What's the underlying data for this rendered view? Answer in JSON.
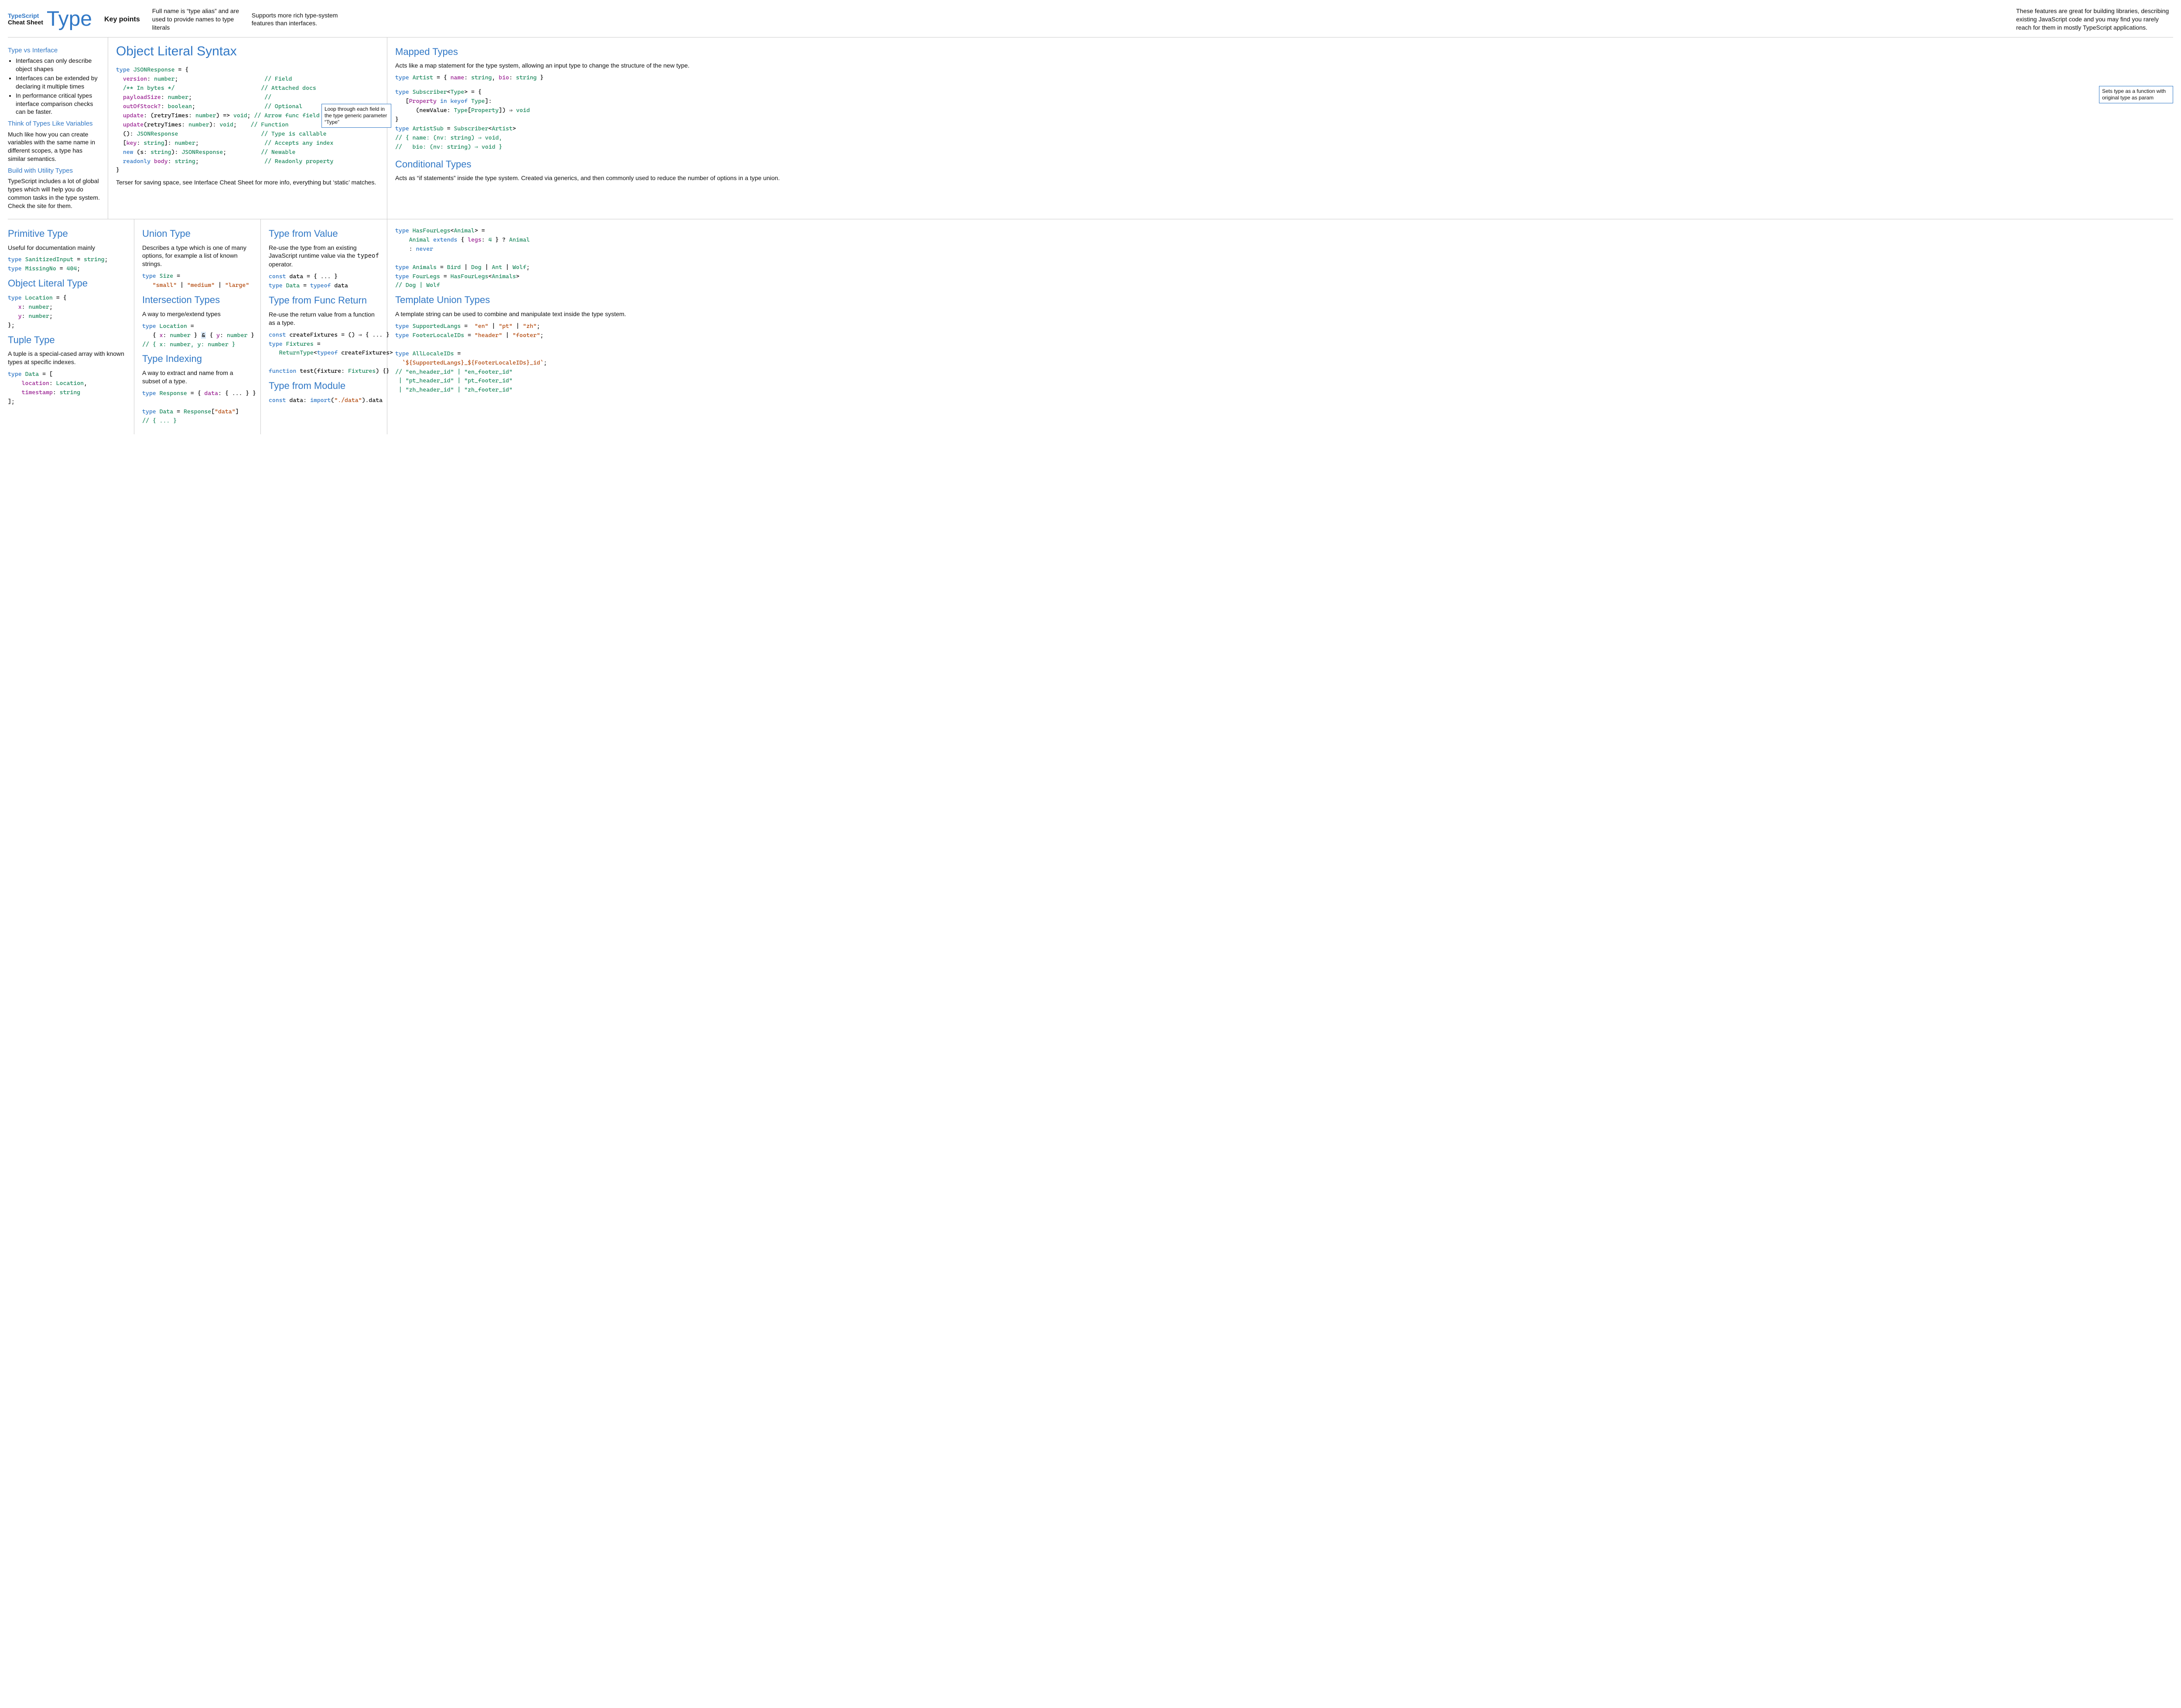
{
  "logo": {
    "small1": "TypeScript",
    "small2": "Cheat Sheet",
    "big": "Type"
  },
  "header": {
    "kp_label": "Key points",
    "kp1": "Full name is “type alias” and are used to provide names to type literals",
    "kp2": "Supports more rich type-system features than interfaces.",
    "kp3": "These features are great for building libraries, describing existing JavaScript code and you may find you rarely reach for them in mostly TypeScript applications."
  },
  "sidebar": {
    "h1": "Type vs Interface",
    "b1": "Interfaces can only describe object shapes",
    "b2": "Interfaces can be extended by declaring it multiple times",
    "b3": "In performance critical types interface comparison checks can be faster.",
    "h2": "Think of Types Like Variables",
    "p2": "Much like how you can create variables with the same name in different scopes, a type has similar semantics.",
    "h3": "Build with Utility Types",
    "p3": "TypeScript includes a lot of global types which will help you do common tasks in the type system. Check the site for them."
  },
  "ols": {
    "title": "Object Literal Syntax",
    "footer": "Terser for saving space, see Interface Cheat Sheet for more info, everything but ‘static’ matches.",
    "lines": {
      "l0": "type JSONResponse = {",
      "l1_key": "version",
      "l1_typ": "number",
      "l1_c": "// Field",
      "l2": "/** In bytes */",
      "l2_c": "// Attached docs",
      "l3_key": "payloadSize",
      "l3_typ": "number",
      "l3_c": "//",
      "l4_key": "outOfStock?",
      "l4_typ": "boolean",
      "l4_c": "// Optional",
      "l5_key": "update",
      "l5_sig": "(retryTimes: number) => void",
      "l5_c": "// Arrow func field",
      "l6_key": "update",
      "l6_sig": "(retryTimes: number): void",
      "l6_c": "// Function",
      "l7_sig": "(): JSONResponse",
      "l7_c": "// Type is callable",
      "l8_key": "[key: string]",
      "l8_typ": "number",
      "l8_c": "// Accepts any index",
      "l9_sig": "new (s: string): JSONResponse",
      "l9_c": "// Newable",
      "l10_kw": "readonly",
      "l10_key": "body",
      "l10_typ": "string",
      "l10_c": "// Readonly property",
      "l11": "}"
    },
    "annot1": "Loop through each field in the type generic parameter “Type”"
  },
  "prim": {
    "h": "Primitive Type",
    "p": "Useful for documentation mainly",
    "c1_name": "SanitizedInput",
    "c1_typ": "string",
    "c2_name": "MissingNo",
    "c2_val": "404"
  },
  "olt": {
    "h": "Object Literal Type",
    "name": "Location",
    "f1": "x",
    "t1": "number",
    "f2": "y",
    "t2": "number"
  },
  "tuple": {
    "h": "Tuple Type",
    "p": "A tuple is a special-cased array with known types at specific indexes.",
    "name": "Data",
    "f1": "location",
    "t1": "Location",
    "f2": "timestamp",
    "t2": "string"
  },
  "union": {
    "h": "Union Type",
    "p": "Describes a type which is one of many options, for example a list of known strings.",
    "name": "Size",
    "v1": "\"small\"",
    "v2": "\"medium\"",
    "v3": "\"large\""
  },
  "inter": {
    "h": "Intersection Types",
    "p": "A way to merge/extend types",
    "name": "Location",
    "line": "{ x: number } & { y: number }",
    "comment": "// { x: number, y: number }"
  },
  "index": {
    "h": "Type Indexing",
    "p": "A way to extract and name from a subset of a type.",
    "l1_name": "Response",
    "l1_body": "{ data: { ... } }",
    "l2_name": "Data",
    "l2_body": "Response[\"data\"]",
    "l2_comment": "// { ... }"
  },
  "tfv": {
    "h": "Type from Value",
    "p": "Re-use the type from an existing JavaScript runtime value via the typeof operator.",
    "l1": "const data = { ... }",
    "l2_name": "Data",
    "l2_body": "typeof data"
  },
  "tfr": {
    "h": "Type from Func Return",
    "p": "Re-use the return value from a function as a type.",
    "l1": "const createFixtures = () ⇒ { ... }",
    "l2_name": "Fixtures",
    "l2_body": "ReturnType<typeof createFixtures>",
    "l3": "function test(fixture: Fixtures) {}"
  },
  "tfm": {
    "h": "Type from Module",
    "l1": "const data: import(\"./data\").data"
  },
  "mapped": {
    "h": "Mapped Types",
    "p": "Acts like a map statement for the type system, allowing an input type to change the structure of the new type.",
    "l1_name": "Artist",
    "l1_body": "{ name: string, bio: string }",
    "l2_name": "Subscriber<Type>",
    "l2_line1": "[Property in keyof Type]:",
    "l2_line2": "(newValue: Type[Property]) ⇒ void",
    "l3_name": "ArtistSub",
    "l3_body": "Subscriber<Artist>",
    "l4": "// { name: (nv: string) ⇒ void,",
    "l5": "//   bio: (nv: string) ⇒ void }",
    "annot": "Sets type as a function with original type as param"
  },
  "cond": {
    "h": "Conditional Types",
    "p": "Acts as “if statements”  inside the type system. Created via generics, and then commonly used to reduce the number of options in a type union.",
    "l1_name": "HasFourLegs<Animal>",
    "l1_body1": "Animal extends { legs: 4 } ? Animal",
    "l1_body2": ": never",
    "l2_name": "Animals",
    "l2_body": "Bird | Dog | Ant | Wolf",
    "l3_name": "FourLegs",
    "l3_body": "HasFourLegs<Animals>",
    "l4": "// Dog | Wolf"
  },
  "tmpl": {
    "h": "Template Union Types",
    "p": "A template string can be used to combine and manipulate text inside the type system.",
    "l1_name": "SupportedLangs",
    "l1_body": " \"en\" | \"pt\" | \"zh\"",
    "l2_name": "FooterLocaleIDs",
    "l2_body": "\"header\" | \"footer\"",
    "l3_name": "AllLocaleIDs",
    "l3_body": "`${SupportedLangs}_${FooterLocaleIDs}_id`",
    "l4": "// \"en_header_id\" | \"en_footer_id\"",
    "l5": " | \"pt_header_id\" | \"pt_footer_id\"",
    "l6": " | \"zh_header_id\" | \"zh_footer_id\""
  }
}
